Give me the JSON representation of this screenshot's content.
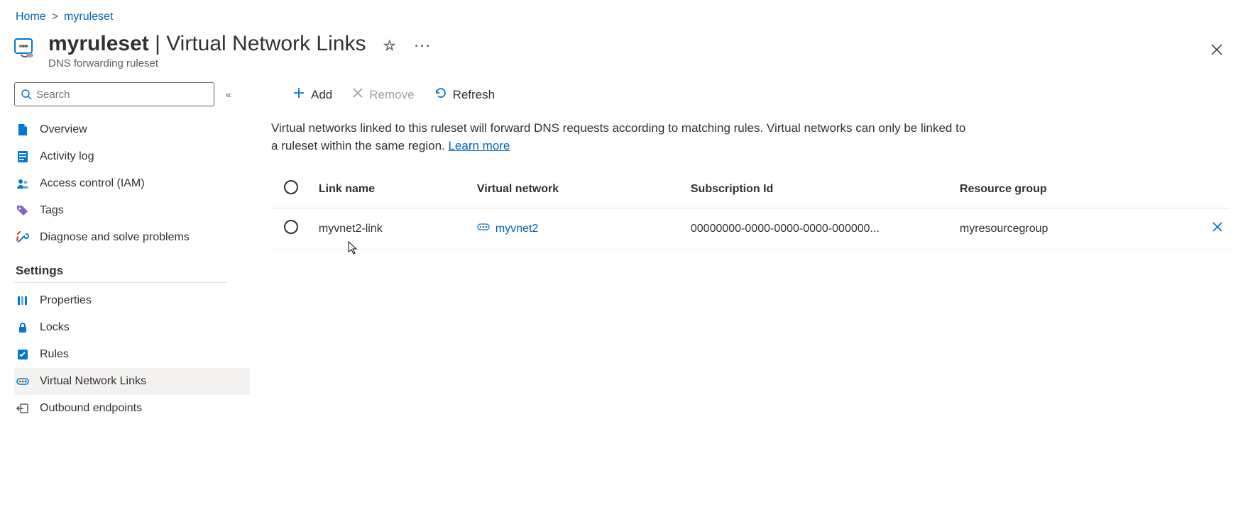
{
  "breadcrumb": {
    "home": "Home",
    "item": "myruleset"
  },
  "header": {
    "title": "myruleset",
    "title_sep": " | ",
    "title_section": "Virtual Network Links",
    "subtitle": "DNS forwarding ruleset"
  },
  "search": {
    "placeholder": "Search"
  },
  "nav": {
    "overview": "Overview",
    "activity_log": "Activity log",
    "access_control": "Access control (IAM)",
    "tags": "Tags",
    "diagnose": "Diagnose and solve problems",
    "settings_label": "Settings",
    "properties": "Properties",
    "locks": "Locks",
    "rules": "Rules",
    "vnetlinks": "Virtual Network Links",
    "outbound": "Outbound endpoints"
  },
  "toolbar": {
    "add": "Add",
    "remove": "Remove",
    "refresh": "Refresh"
  },
  "description": {
    "text": "Virtual networks linked to this ruleset will forward DNS requests according to matching rules. Virtual networks can only be linked to a ruleset within the same region. ",
    "learn_more": "Learn more"
  },
  "table": {
    "headers": {
      "link_name": "Link name",
      "vnet": "Virtual network",
      "sub": "Subscription Id",
      "rg": "Resource group"
    },
    "row0": {
      "link_name": "myvnet2-link",
      "vnet": "myvnet2",
      "sub": "00000000-0000-0000-0000-000000...",
      "rg": "myresourcegroup"
    }
  }
}
